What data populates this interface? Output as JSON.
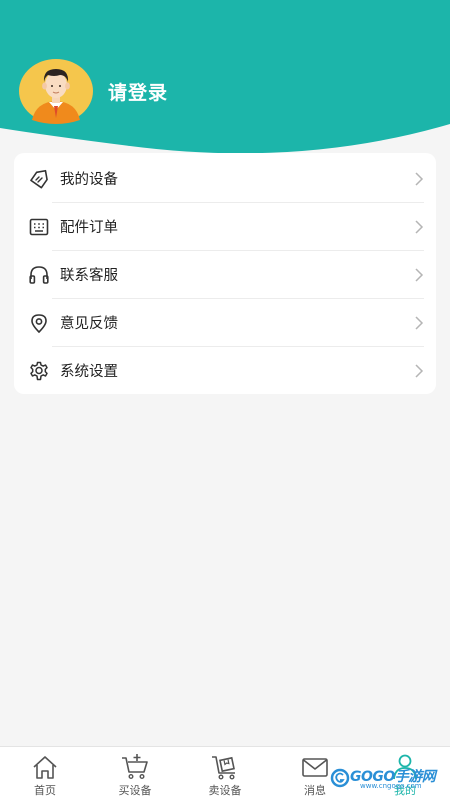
{
  "header": {
    "background_color": "#1cb5aa",
    "login_label": "请登录",
    "avatar_icon": "user-avatar-icon"
  },
  "menu": {
    "items": [
      {
        "label": "我的设备",
        "icon": "tag-icon"
      },
      {
        "label": "配件订单",
        "icon": "keyboard-icon"
      },
      {
        "label": "联系客服",
        "icon": "headphones-icon"
      },
      {
        "label": "意见反馈",
        "icon": "location-pin-icon"
      },
      {
        "label": "系统设置",
        "icon": "gear-icon"
      }
    ]
  },
  "tabbar": {
    "accent_color": "#1cb5aa",
    "tabs": [
      {
        "label": "首页",
        "icon": "home-icon"
      },
      {
        "label": "买设备",
        "icon": "cart-plus-icon"
      },
      {
        "label": "卖设备",
        "icon": "cart-box-icon"
      },
      {
        "label": "消息",
        "icon": "mail-icon"
      },
      {
        "label": "我的",
        "icon": "person-icon",
        "active": true
      }
    ]
  },
  "watermark": {
    "brand": "GOGO手游网",
    "url": "www.cngogo.com"
  }
}
